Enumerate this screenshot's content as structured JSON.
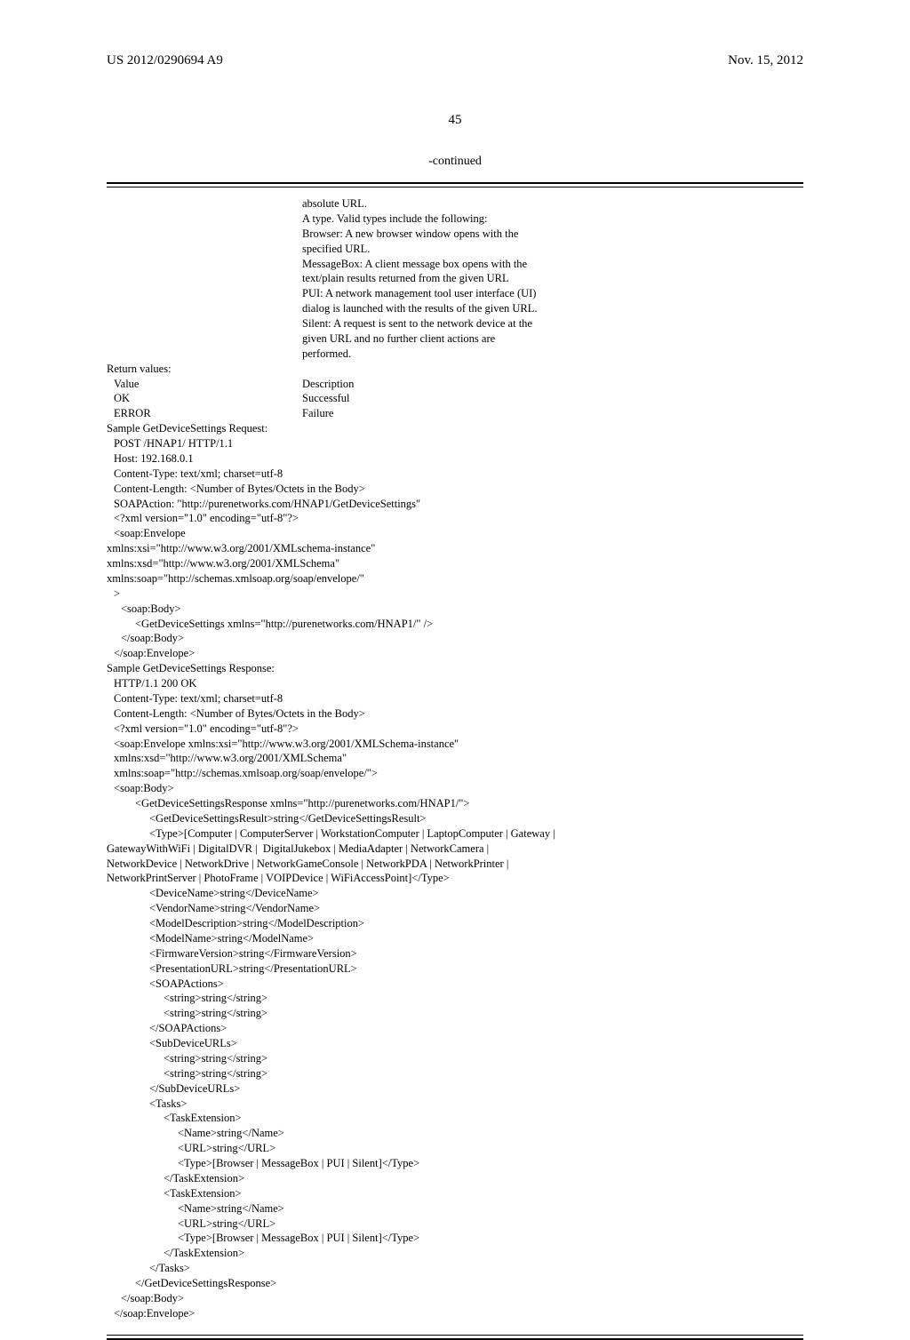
{
  "header": {
    "pub_number": "US 2012/0290694 A9",
    "pub_date": "Nov. 15, 2012"
  },
  "page_number": "45",
  "continued_label": "-continued",
  "body_lines": [
    {
      "indent": 220,
      "text": "absolute URL."
    },
    {
      "indent": 220,
      "text": "A type. Valid types include the following:"
    },
    {
      "indent": 220,
      "text": "Browser: A new browser window opens with the"
    },
    {
      "indent": 220,
      "text": "specified URL."
    },
    {
      "indent": 220,
      "text": "MessageBox: A client message box opens with the"
    },
    {
      "indent": 220,
      "text": "text/plain results returned from the given URL"
    },
    {
      "indent": 220,
      "text": "PUI: A network management tool user interface (UI)"
    },
    {
      "indent": 220,
      "text": "dialog is launched with the results of the given URL."
    },
    {
      "indent": 220,
      "text": "Silent: A request is sent to the network device at the"
    },
    {
      "indent": 220,
      "text": "given URL and no further client actions are"
    },
    {
      "indent": 220,
      "text": "performed."
    },
    {
      "indent": 0,
      "text": "Return values:"
    },
    {
      "indent": 8,
      "left": "Value",
      "right": "Description"
    },
    {
      "indent": 8,
      "left": "OK",
      "right": "Successful"
    },
    {
      "indent": 8,
      "left": "ERROR",
      "right": "Failure"
    },
    {
      "indent": 0,
      "text": "Sample GetDeviceSettings Request:"
    },
    {
      "indent": 8,
      "text": "POST /HNAP1/ HTTP/1.1"
    },
    {
      "indent": 8,
      "text": "Host: 192.168.0.1"
    },
    {
      "indent": 8,
      "text": "Content-Type: text/xml; charset=utf-8"
    },
    {
      "indent": 8,
      "text": "Content-Length: <Number of Bytes/Octets in the Body>"
    },
    {
      "indent": 8,
      "text": "SOAPAction: \"http://purenetworks.com/HNAP1/GetDeviceSettings\""
    },
    {
      "indent": 8,
      "text": "<?xml version=\"1.0\" encoding=\"utf-8\"?>"
    },
    {
      "indent": 8,
      "text": "<soap:Envelope"
    },
    {
      "indent": 0,
      "text": "xmlns:xsi=\"http://www.w3.org/2001/XMLschema-instance\""
    },
    {
      "indent": 0,
      "text": "xmlns:xsd=\"http://www.w3.org/2001/XMLSchema\""
    },
    {
      "indent": 0,
      "text": "xmlns:soap=\"http://schemas.xmlsoap.org/soap/envelope/\""
    },
    {
      "indent": 8,
      "text": ">"
    },
    {
      "indent": 16,
      "text": "<soap:Body>"
    },
    {
      "indent": 32,
      "text": "<GetDeviceSettings xmlns=\"http://purenetworks.com/HNAP1/\" />"
    },
    {
      "indent": 16,
      "text": "</soap:Body>"
    },
    {
      "indent": 8,
      "text": "</soap:Envelope>"
    },
    {
      "indent": 0,
      "text": "Sample GetDeviceSettings Response:"
    },
    {
      "indent": 8,
      "text": "HTTP/1.1 200 OK"
    },
    {
      "indent": 8,
      "text": "Content-Type: text/xml; charset=utf-8"
    },
    {
      "indent": 8,
      "text": "Content-Length: <Number of Bytes/Octets in the Body>"
    },
    {
      "indent": 8,
      "text": "<?xml version=\"1.0\" encoding=\"utf-8\"?>"
    },
    {
      "indent": 8,
      "text": "<soap:Envelope xmlns:xsi=\"http://www.w3.org/2001/XMLSchema-instance\""
    },
    {
      "indent": 8,
      "text": "xmlns:xsd=\"http://www.w3.org/2001/XMLSchema\""
    },
    {
      "indent": 8,
      "text": "xmlns:soap=\"http://schemas.xmlsoap.org/soap/envelope/\">"
    },
    {
      "indent": 8,
      "text": "<soap:Body>"
    },
    {
      "indent": 32,
      "text": "<GetDeviceSettingsResponse xmlns=\"http://purenetworks.com/HNAP1/\">"
    },
    {
      "indent": 48,
      "text": "<GetDeviceSettingsResult>string</GetDeviceSettingsResult>"
    },
    {
      "indent": 48,
      "text": "<Type>[Computer | ComputerServer | WorkstationComputer | LaptopComputer | Gateway |"
    },
    {
      "indent": 0,
      "text": "GatewayWithWiFi | DigitalDVR |  DigitalJukebox | MediaAdapter | NetworkCamera |"
    },
    {
      "indent": 0,
      "text": "NetworkDevice | NetworkDrive | NetworkGameConsole | NetworkPDA | NetworkPrinter |"
    },
    {
      "indent": 0,
      "text": "NetworkPrintServer | PhotoFrame | VOIPDevice | WiFiAccessPoint]</Type>"
    },
    {
      "indent": 48,
      "text": "<DeviceName>string</DeviceName>"
    },
    {
      "indent": 48,
      "text": "<VendorName>string</VendorName>"
    },
    {
      "indent": 48,
      "text": "<ModelDescription>string</ModelDescription>"
    },
    {
      "indent": 48,
      "text": "<ModelName>string</ModelName>"
    },
    {
      "indent": 48,
      "text": "<FirmwareVersion>string</FirmwareVersion>"
    },
    {
      "indent": 48,
      "text": "<PresentationURL>string</PresentationURL>"
    },
    {
      "indent": 48,
      "text": "<SOAPActions>"
    },
    {
      "indent": 64,
      "text": "<string>string</string>"
    },
    {
      "indent": 64,
      "text": "<string>string</string>"
    },
    {
      "indent": 48,
      "text": "</SOAPActions>"
    },
    {
      "indent": 48,
      "text": "<SubDeviceURLs>"
    },
    {
      "indent": 64,
      "text": "<string>string</string>"
    },
    {
      "indent": 64,
      "text": "<string>string</string>"
    },
    {
      "indent": 48,
      "text": "</SubDeviceURLs>"
    },
    {
      "indent": 48,
      "text": "<Tasks>"
    },
    {
      "indent": 64,
      "text": "<TaskExtension>"
    },
    {
      "indent": 80,
      "text": "<Name>string</Name>"
    },
    {
      "indent": 80,
      "text": "<URL>string</URL>"
    },
    {
      "indent": 80,
      "text": "<Type>[Browser | MessageBox | PUI | Silent]</Type>"
    },
    {
      "indent": 64,
      "text": "</TaskExtension>"
    },
    {
      "indent": 64,
      "text": "<TaskExtension>"
    },
    {
      "indent": 80,
      "text": "<Name>string</Name>"
    },
    {
      "indent": 80,
      "text": "<URL>string</URL>"
    },
    {
      "indent": 80,
      "text": "<Type>[Browser | MessageBox | PUI | Silent]</Type>"
    },
    {
      "indent": 64,
      "text": "</TaskExtension>"
    },
    {
      "indent": 48,
      "text": "</Tasks>"
    },
    {
      "indent": 32,
      "text": "</GetDeviceSettingsResponse>"
    },
    {
      "indent": 16,
      "text": "</soap:Body>"
    },
    {
      "indent": 8,
      "text": "</soap:Envelope>"
    }
  ]
}
